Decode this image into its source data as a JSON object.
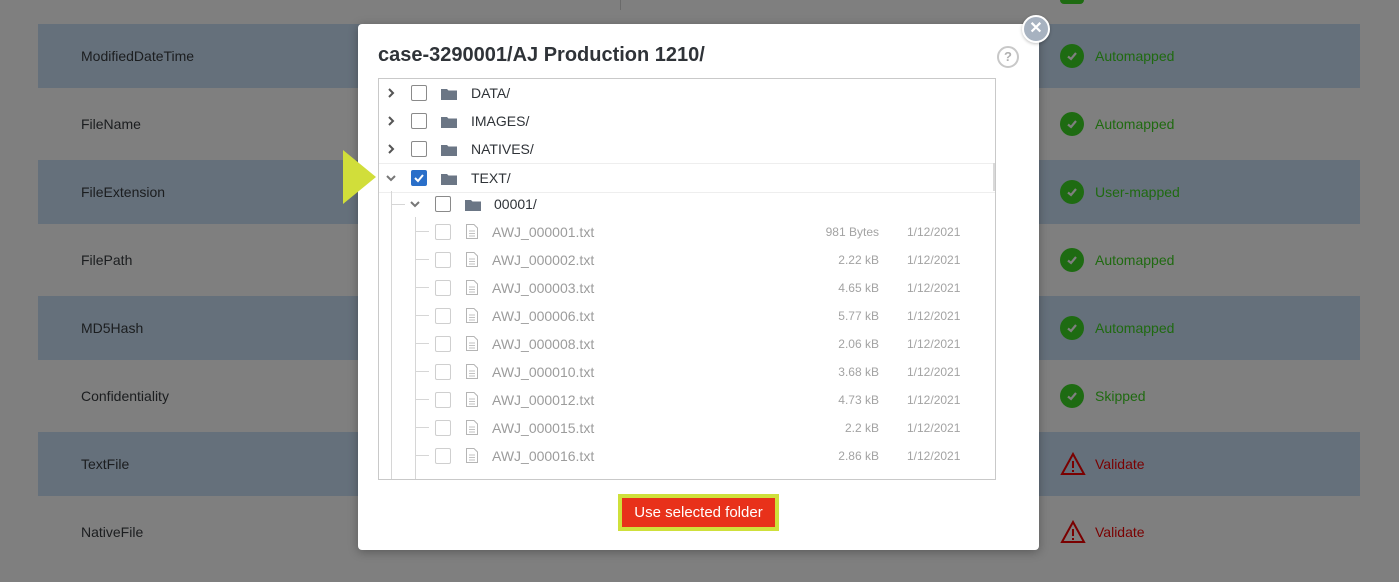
{
  "background": {
    "rows": [
      {
        "field": "ModifiedDateTime",
        "status": "Automapped",
        "kind": "ok",
        "shaded": true
      },
      {
        "field": "FileName",
        "status": "Automapped",
        "kind": "ok",
        "shaded": false
      },
      {
        "field": "FileExtension",
        "status": "User-mapped",
        "kind": "ok",
        "shaded": true
      },
      {
        "field": "FilePath",
        "status": "Automapped",
        "kind": "ok",
        "shaded": false
      },
      {
        "field": "MD5Hash",
        "status": "Automapped",
        "kind": "ok",
        "shaded": true
      },
      {
        "field": "Confidentiality",
        "status": "Skipped",
        "kind": "ok",
        "shaded": false
      },
      {
        "field": "TextFile",
        "status": "Validate",
        "kind": "warn",
        "shaded": true
      },
      {
        "field": "NativeFile",
        "status": "Validate",
        "kind": "warn",
        "shaded": false
      }
    ]
  },
  "modal": {
    "title": "case-3290001/AJ Production 1210/",
    "help_icon": "question-circle-icon",
    "close_icon": "close-icon",
    "action_label": "Use selected folder"
  },
  "tree": {
    "folders": [
      {
        "name": "DATA/",
        "checked": false,
        "expanded": false
      },
      {
        "name": "IMAGES/",
        "checked": false,
        "expanded": false
      },
      {
        "name": "NATIVES/",
        "checked": false,
        "expanded": false
      },
      {
        "name": "TEXT/",
        "checked": true,
        "expanded": true
      }
    ],
    "subfolder": {
      "name": "00001/",
      "checked": false,
      "expanded": true
    },
    "files": [
      {
        "name": "AWJ_000001.txt",
        "size": "981 Bytes",
        "date": "1/12/2021"
      },
      {
        "name": "AWJ_000002.txt",
        "size": "2.22 kB",
        "date": "1/12/2021"
      },
      {
        "name": "AWJ_000003.txt",
        "size": "4.65 kB",
        "date": "1/12/2021"
      },
      {
        "name": "AWJ_000006.txt",
        "size": "5.77 kB",
        "date": "1/12/2021"
      },
      {
        "name": "AWJ_000008.txt",
        "size": "2.06 kB",
        "date": "1/12/2021"
      },
      {
        "name": "AWJ_000010.txt",
        "size": "3.68 kB",
        "date": "1/12/2021"
      },
      {
        "name": "AWJ_000012.txt",
        "size": "4.73 kB",
        "date": "1/12/2021"
      },
      {
        "name": "AWJ_000015.txt",
        "size": "2.2 kB",
        "date": "1/12/2021"
      },
      {
        "name": "AWJ_000016.txt",
        "size": "2.86 kB",
        "date": "1/12/2021"
      }
    ]
  },
  "colors": {
    "accent_button": "#e8311a",
    "highlight": "#cfe03b",
    "checkbox_checked": "#2a6fc9"
  }
}
